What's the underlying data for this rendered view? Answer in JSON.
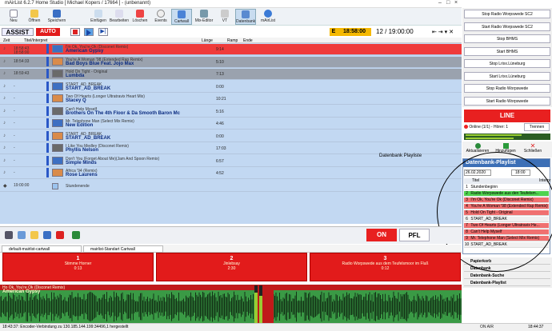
{
  "window": {
    "title": "mAirList 6.2.7 Home Studio [ Michael Kopers / 17664 ] - (unbenannt)"
  },
  "toolbar": {
    "items": [
      "Neu",
      "Öffnen",
      "Speichern",
      "Einfügen",
      "Bearbeiten",
      "Löschen",
      "Events",
      "Cartwall",
      "Mix-Editor",
      "VT",
      "Datenbank",
      "mAirList"
    ]
  },
  "control": {
    "assist": "ASSIST",
    "auto": "AUTO",
    "clock_prefix": "E",
    "clock": "18:58:00",
    "counter": "12 / 19:00:00"
  },
  "playlist_header": {
    "zeit": "Zeit",
    "titel": "Titel/Interpret",
    "laenge": "Länge",
    "ramp": "Ramp",
    "ende": "Ende"
  },
  "playlist": [
    {
      "time": "18:58:43",
      "sub": "18:58:00",
      "line1": "I'm Ok, You're Ok (Disconet Remix)",
      "line2": "American Gypsy",
      "dur": "9:14",
      "state": "playing"
    },
    {
      "time": "18:54:33",
      "line1": "You're A Woman '98 (Extended Rap Remix)",
      "line2": "Bad Boys Blue Feat. Jojo Max",
      "dur": "5:10",
      "state": "played"
    },
    {
      "time": "18:59:43",
      "line1": "Hold On Tight - Original",
      "line2": "Lumbda",
      "dur": "7:13",
      "state": "played"
    },
    {
      "time": "-",
      "line1": "START_AD_BREAK",
      "line2": "START_AD_BREAK",
      "dur": "0:00",
      "state": "next"
    },
    {
      "time": "-",
      "line1": "Two Of Hearts (Longer Ultratravix Heart Mix)",
      "line2": "Stacey Q",
      "dur": "10:21",
      "state": "next"
    },
    {
      "time": "-",
      "line1": "Can't Help Myself",
      "line2": "Brothers On The 4th Floor & Da Smooth Baron Mc",
      "dur": "5:16",
      "state": "next"
    },
    {
      "time": "-",
      "line1": "Mr. Telephone Man (Select Mix Remix)",
      "line2": "New Edition",
      "dur": "4:46",
      "state": "next"
    },
    {
      "time": "-",
      "line1": "START_AD_BREAK",
      "line2": "START_AD_BREAK",
      "dur": "0:00",
      "state": "next"
    },
    {
      "time": "-",
      "line1": "I Like You Medley (Disconet Remix)",
      "line2": "Phyllis Nelson",
      "dur": "17:03",
      "state": "next"
    },
    {
      "time": "-",
      "line1": "Don't You (Forget About Me)(Jam And Spoon Remix)",
      "line2": "Simple Minds",
      "dur": "6:57",
      "state": "next"
    },
    {
      "time": "-",
      "line1": "Africa '94 (Remix)",
      "line2": "Rose Laurens",
      "dur": "4:52",
      "state": "next"
    },
    {
      "time": "19:00:00",
      "line1": "",
      "line2": "Stundenende",
      "dur": "",
      "state": "end"
    }
  ],
  "right_buttons": [
    "Stop Radio Worpswede SC2",
    "Start Radio Worpswede SC2",
    "Stop BHMS",
    "Start BHMS",
    "Stop Lrixx.Lüneburg",
    "Start Lrixx.Lüneburg",
    "Stop Radio Worpswede",
    "Start Radio Worpswede"
  ],
  "stream": {
    "line": "LINE",
    "online": "Online (1/1) - Hörer: 1",
    "trennen": "Trennen"
  },
  "db_tools": [
    "Aktualisieren",
    "Hinzufügen",
    "Schließen"
  ],
  "db_panel": {
    "title": "Datenbank-Playlist",
    "date": "26.02.2020",
    "hour": "18:00",
    "col_title": "Titel",
    "col_artist": "Interpr",
    "rows": [
      {
        "n": "1",
        "text": "Stundenbeginn",
        "color": "#ffffff"
      },
      {
        "n": "2",
        "text": "Radio Worpswede aus den Teufelsm...",
        "color": "#4fd34f"
      },
      {
        "n": "3",
        "text": "I'm Ok, You're Ok (Disconet Remix)",
        "color": "#f07070"
      },
      {
        "n": "4",
        "text": "You're A Woman '98 (Extended Rap Remix)",
        "color": "#f07070"
      },
      {
        "n": "5",
        "text": "Hold On Tight - Original",
        "color": "#f07070"
      },
      {
        "n": "6",
        "text": "START_AD_BREAK",
        "color": "#f0f0f0"
      },
      {
        "n": "7",
        "text": "Two Of Hearts (Longer Ultratravix He...",
        "color": "#f07070"
      },
      {
        "n": "8",
        "text": "Can't Help Myself",
        "color": "#f07070"
      },
      {
        "n": "9",
        "text": "Mr. Telephone Man (Select Mix Remix)",
        "color": "#f07070"
      },
      {
        "n": "10",
        "text": "START_AD_BREAK",
        "color": "#f0f0f0"
      }
    ]
  },
  "db_tabs": [
    "Papierkorb",
    "Datenbank",
    "Datenbank-Suche",
    "Datenbank-Playlist"
  ],
  "annotation": "Datenbank Playliste",
  "bottom": {
    "on": "ON",
    "pfl": "PFL"
  },
  "cartwall_tabs": [
    "default-mairlist-cartwall",
    "mairlist-Standart Cartwall"
  ],
  "carts": [
    {
      "num": "1",
      "title": "Stimme Horner",
      "dur": "0:13"
    },
    {
      "num": "2",
      "title": "Jinlebsay",
      "dur": "2:30"
    },
    {
      "num": "3",
      "title": "Radio Worpswede aus dem Teufelsmoor im Fluß",
      "dur": "0:12"
    }
  ],
  "player": {
    "label": "Ho Ok, You're Ok (Disconet Remix)",
    "title": "American Gypsy"
  },
  "status": {
    "left": "18:43:37: Encoder-Verbindung zu 130.185.144.199:34496,1 hergestellt",
    "onair": "ON AIR",
    "time": "18:44:37"
  }
}
